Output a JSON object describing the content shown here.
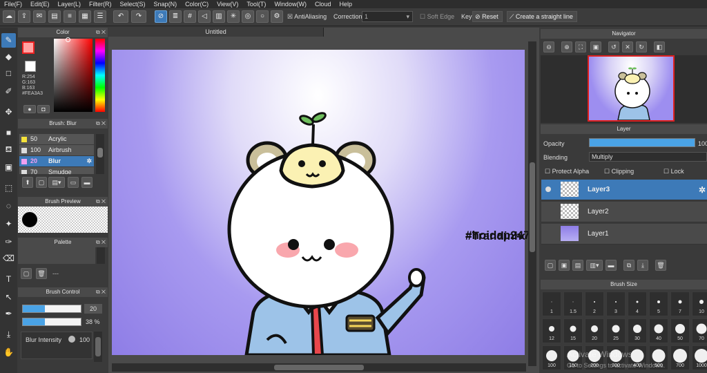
{
  "menu": [
    "File(F)",
    "Edit(E)",
    "Layer(L)",
    "Filter(R)",
    "Select(S)",
    "Snap(N)",
    "Color(C)",
    "View(V)",
    "Tool(T)",
    "Window(W)",
    "Cloud",
    "Help"
  ],
  "toolbar": {
    "antialias": "AntiAliasing",
    "correction_label": "Correction",
    "correction_value": "1",
    "soft_edge": "Soft Edge",
    "key": "Key",
    "reset": "Reset",
    "straight": "Create a straight line"
  },
  "color_panel": {
    "title": "Color",
    "r": "R:254",
    "g": "G:163",
    "b": "B:163",
    "hex": "#FEA3A3",
    "current_color": "#fea3a3"
  },
  "brush_panel": {
    "title": "Brush: Blur",
    "items": [
      {
        "size": "50",
        "name": "Acrylic",
        "color": "#f5e23a"
      },
      {
        "size": "100",
        "name": "Airbrush",
        "color": "#dddddd"
      },
      {
        "size": "20",
        "name": "Blur",
        "color": "#f0a0f0"
      },
      {
        "size": "70",
        "name": "Smudge",
        "color": "#dddddd"
      }
    ]
  },
  "brush_preview": {
    "title": "Brush Preview"
  },
  "palette": {
    "title": "Palette",
    "empty": "---"
  },
  "brush_control": {
    "title": "Brush Control",
    "size": "20",
    "opacity": "38 %",
    "intensity_label": "Blur Intensity",
    "intensity": "100"
  },
  "canvas": {
    "tab": "Untitled"
  },
  "watermark": {
    "line1": "#Trandinhchien11",
    "line2": "#hoidap247"
  },
  "navigator": {
    "title": "Navigator"
  },
  "layer_panel": {
    "title": "Layer",
    "opacity_label": "Opacity",
    "opacity_value": "100",
    "blending_label": "Blending",
    "blending_value": "Multiply",
    "protect_alpha": "Protect Alpha",
    "clipping": "Clipping",
    "lock": "Lock",
    "layers": [
      {
        "name": "Layer3"
      },
      {
        "name": "Layer2"
      },
      {
        "name": "Layer1"
      }
    ]
  },
  "brush_size": {
    "title": "Brush Size",
    "sizes": [
      "1",
      "1.5",
      "2",
      "3",
      "4",
      "5",
      "7",
      "10",
      "12",
      "15",
      "20",
      "25",
      "30",
      "40",
      "50",
      "70",
      "100",
      "150",
      "200",
      "300",
      "400",
      "500",
      "700",
      "1000"
    ]
  },
  "os_watermark": {
    "line1": "Activate Windows",
    "line2": "Go to Settings to activate Windows."
  }
}
